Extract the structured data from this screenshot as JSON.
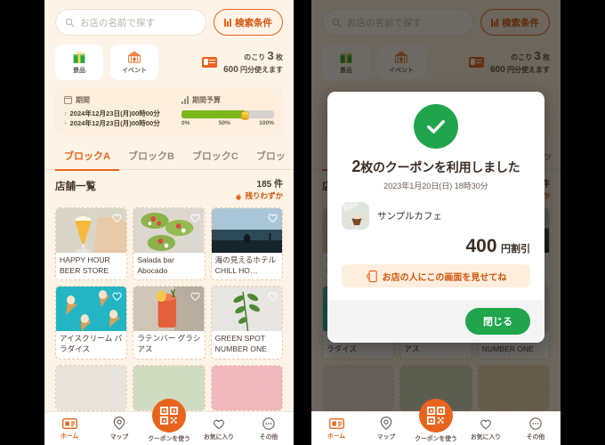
{
  "app": {
    "search": {
      "placeholder": "お店の名前で探す",
      "icon": "search-icon"
    },
    "filter_button": {
      "label": "検索条件",
      "icon": "sliders-icon"
    },
    "chips": [
      {
        "label": "景品",
        "icon": "gift-icon"
      },
      {
        "label": "イベント",
        "icon": "tent-icon"
      }
    ],
    "ticket": {
      "icon": "ticket-icon",
      "remaining_prefix": "のこり",
      "remaining_count": "3",
      "remaining_unit": "枚",
      "value_amount": "600",
      "value_suffix": "円分使えます"
    },
    "period_panel": {
      "period_label": "期間",
      "period_icon": "calendar-icon",
      "date_start": "2024年12月23日(月)00時00分",
      "date_end": "2024年12月23日(月)00時00分",
      "budget_label": "期間予算",
      "budget_icon": "bar-chart-icon",
      "progress_percent": 68,
      "scale": [
        "0%",
        "50%",
        "100%"
      ]
    },
    "tabs": [
      {
        "label": "ブロックA",
        "active": true
      },
      {
        "label": "ブロックB",
        "active": false
      },
      {
        "label": "ブロックC",
        "active": false
      },
      {
        "label": "ブロッ",
        "active": false
      }
    ],
    "list_header": {
      "title": "店舗一覧",
      "count": "185 件",
      "few_left": "残りわずか",
      "few_icon": "fire-icon"
    },
    "shops": [
      {
        "name": "HAPPY HOUR BEER STORE",
        "image": "beer-glass-photo",
        "favorite_icon": "heart-icon"
      },
      {
        "name": "Salada bar Abocado",
        "image": "avocado-salad-photo",
        "favorite_icon": "heart-icon"
      },
      {
        "name": "海の見えるホテル CHILL HO…",
        "image": "ocean-hotel-photo",
        "favorite_icon": "heart-icon"
      },
      {
        "name": "アイスクリーム パラダイス",
        "image": "ice-cream-cones-photo",
        "favorite_icon": "heart-icon"
      },
      {
        "name": "ラテンバー グラシアス",
        "image": "cocktail-photo",
        "favorite_icon": "heart-icon"
      },
      {
        "name": "GREEN SPOT NUMBER ONE",
        "image": "green-plant-photo",
        "favorite_icon": "heart-icon"
      }
    ],
    "bottom_nav": [
      {
        "label": "ホーム",
        "icon": "ticket-outline-icon",
        "active": true
      },
      {
        "label": "マップ",
        "icon": "map-pin-icon",
        "active": false
      },
      {
        "label": "クーポンを使う",
        "icon": "qr-code-icon",
        "active": false,
        "is_fab": true
      },
      {
        "label": "お気に入り",
        "icon": "heart-outline-icon",
        "active": false
      },
      {
        "label": "その他",
        "icon": "ellipsis-icon",
        "active": false
      }
    ]
  },
  "modal": {
    "status_icon": "check-circle-icon",
    "title_count": "2",
    "title_rest": "枚のクーポンを利用しました",
    "datetime": "2023年1月20日(日) 18時30分",
    "shop_name": "サンプルカフェ",
    "shop_image": "latte-cup-photo",
    "discount_amount": "400",
    "discount_suffix": "円割引",
    "notice_text": "お店の人にこの画面を見せてね",
    "notice_icon": "show-phone-icon",
    "close_label": "閉じる"
  },
  "colors": {
    "accent": "#e8641c",
    "accent_dark": "#d4550d",
    "bg": "#fdf3e7",
    "panel": "#fdeedd",
    "green": "#20a54c",
    "progress_green": "#7cb518",
    "text": "#4a3b30",
    "muted": "#9b8c7f"
  }
}
